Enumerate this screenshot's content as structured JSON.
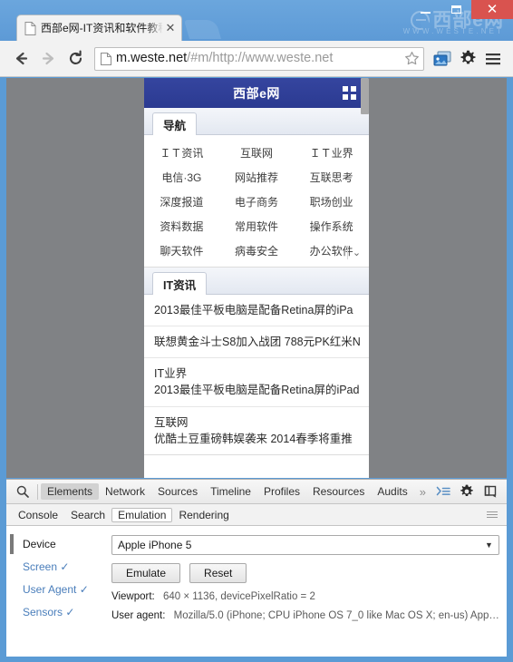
{
  "window": {
    "watermark_text": "西部e网",
    "watermark_sub": "WWW.WESTE.NET",
    "minimize_label": "—",
    "maximize_label": "□",
    "close_label": "✕"
  },
  "tab": {
    "title": "西部e网-IT资讯和软件教程",
    "close_label": "✕",
    "favicon": "page-icon"
  },
  "toolbar": {
    "back": "←",
    "forward": "→",
    "reload": "⟳",
    "url_host": "m.weste.net",
    "url_path": "/#m/http://www.weste.net",
    "star": "☆",
    "apps_icon": "image-extension-icon",
    "settings_icon": "gear-icon",
    "menu_icon": "hamburger-menu-icon"
  },
  "page": {
    "site_title": "西部e网",
    "grid_icon": "grid-menu-icon",
    "nav_tab": "导航",
    "nav_items": [
      "ＩＴ资讯",
      "互联网",
      "ＩＴ业界",
      "电信·3G",
      "网站推荐",
      "互联思考",
      "深度报道",
      "电子商务",
      "职场创业",
      "资料数据",
      "常用软件",
      "操作系统",
      "聊天软件",
      "病毒安全",
      "办公软件"
    ],
    "nav_more": "⌄",
    "news_tab": "IT资讯",
    "news_items": [
      {
        "category": "",
        "text": "2013最佳平板电脑是配备Retina屏的iPa"
      },
      {
        "category": "",
        "text": "联想黄金斗士S8加入战团 788元PK红米N"
      },
      {
        "category": "IT业界",
        "text": "2013最佳平板电脑是配备Retina屏的iPad"
      },
      {
        "category": "互联网",
        "text": "优酷土豆重磅韩娱袭来 2014春季将重推"
      }
    ]
  },
  "devtools": {
    "search_icon": "search-icon",
    "tabs": [
      {
        "label": "Elements",
        "active": true
      },
      {
        "label": "Network",
        "active": false
      },
      {
        "label": "Sources",
        "active": false
      },
      {
        "label": "Timeline",
        "active": false
      },
      {
        "label": "Profiles",
        "active": false
      },
      {
        "label": "Resources",
        "active": false
      },
      {
        "label": "Audits",
        "active": false
      }
    ],
    "more_label": "»",
    "console_toggle_icon": "console-drawer-icon",
    "settings_icon": "gear-icon",
    "dock_icon": "dock-side-icon",
    "close_icon": "close-icon",
    "close_label": "✕",
    "drawer_tabs": [
      {
        "label": "Console",
        "active": false
      },
      {
        "label": "Search",
        "active": false
      },
      {
        "label": "Emulation",
        "active": true
      },
      {
        "label": "Rendering",
        "active": false
      }
    ],
    "emulation": {
      "side_items": [
        {
          "label": "Device",
          "check": "",
          "active": true
        },
        {
          "label": "Screen",
          "check": "✓",
          "active": false
        },
        {
          "label": "User Agent",
          "check": "✓",
          "active": false
        },
        {
          "label": "Sensors",
          "check": "✓",
          "active": false
        }
      ],
      "device_value": "Apple iPhone 5",
      "device_arrow": "▼",
      "emulate_label": "Emulate",
      "reset_label": "Reset",
      "viewport_label": "Viewport:",
      "viewport_value": "640 × 1136, devicePixelRatio = 2",
      "useragent_label": "User agent:",
      "useragent_value": "Mozilla/5.0 (iPhone; CPU iPhone OS 7_0 like Mac OS X; en-us) App…"
    }
  },
  "colors": {
    "window_frame": "#5b9bd5",
    "site_header": "#2b3f9e",
    "viewport_bg": "#808285",
    "close_button": "#d9534f",
    "link_blue": "#4a7ebb"
  }
}
